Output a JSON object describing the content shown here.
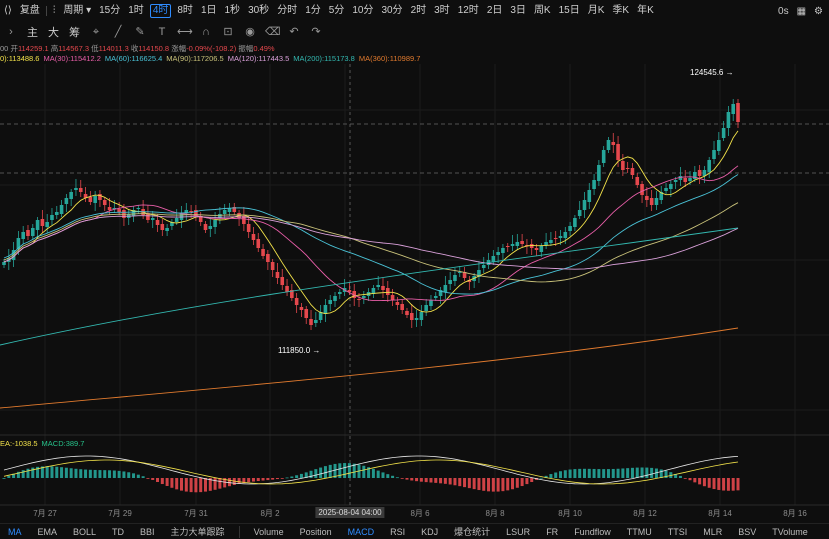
{
  "toolbar": {
    "replay": "复盘",
    "period_label": "周期",
    "periods": [
      "15分",
      "1时",
      "4时",
      "8时",
      "1日",
      "1秒",
      "30秒",
      "分时",
      "1分",
      "5分",
      "10分",
      "30分",
      "2时",
      "3时",
      "12时",
      "2日",
      "3日",
      "周K",
      "15日",
      "月K",
      "季K",
      "年K"
    ],
    "active_period": "4时",
    "right": [
      "0s"
    ]
  },
  "row2": {
    "tabs": [
      "主",
      "大",
      "筹"
    ]
  },
  "info": {
    "prefix": "00",
    "open_label": "开",
    "open": "114259.1",
    "high_label": "高",
    "high": "114567.3",
    "low_label": "低",
    "low": "114011.3",
    "close_label": "收",
    "close": "114150.8",
    "change_label": "涨幅",
    "change": "-0.09%(-108.2)",
    "amp_label": "振幅",
    "amp": "0.49%"
  },
  "ma_legend": [
    {
      "text": "0):113488.6",
      "color": "#f2e24a"
    },
    {
      "text": "MA(30):115412.2",
      "color": "#e85ea8"
    },
    {
      "text": "MA(60):116625.4",
      "color": "#4ac2d6"
    },
    {
      "text": "MA(90):117206.5",
      "color": "#c9c27a"
    },
    {
      "text": "MA(120):117443.5",
      "color": "#d9a0d9"
    },
    {
      "text": "MA(200):115173.8",
      "color": "#33b8b0"
    },
    {
      "text": "MA(360):110989.7",
      "color": "#e07a2e"
    }
  ],
  "macd_legend": [
    {
      "text": "EA:-1038.5",
      "color": "#f2e24a"
    },
    {
      "text": "MACD:389.7",
      "color": "#26c28a"
    }
  ],
  "annotations": {
    "high": "124545.6",
    "low": "111850.0",
    "crosshair_time": "2025-08-04 04:00"
  },
  "bottom_tabs": [
    "MA",
    "EMA",
    "BOLL",
    "TD",
    "BBI",
    "主力大单跟踪",
    "Volume",
    "Position",
    "MACD",
    "RSI",
    "KDJ",
    "爆仓统计",
    "LSUR",
    "FR",
    "Fundflow",
    "TTMU",
    "TTSI",
    "MLR",
    "BSV",
    "TVolume"
  ],
  "bottom_active": [
    "MA",
    "MACD"
  ],
  "chart_data": {
    "type": "candlestick",
    "x_ticks": [
      "7月 27",
      "7月 29",
      "7月 31",
      "8月 2",
      "8月 4",
      "8月 6",
      "8月 8",
      "8月 10",
      "8月 12",
      "8月 14",
      "8月 16"
    ],
    "colors": {
      "up": "#26a69a",
      "down": "#e5484d"
    }
  }
}
